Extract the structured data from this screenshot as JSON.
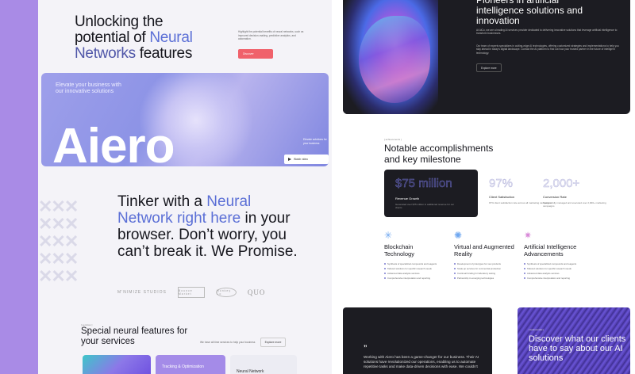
{
  "left": {
    "hero": {
      "line1": "Unlocking the",
      "line2a": "potential of ",
      "line2b": "Neural",
      "line3a": "Networks",
      "line3b": " features",
      "desc": "Highlight the potential benefits of neural networks, such as improved decision-making, predictive analytics, and automation.",
      "button": "Discover"
    },
    "banner": {
      "tagline": "Elevate your business with our innovative solutions",
      "brand": "Aiero",
      "side_text": "Elevate solutions for your business",
      "watch": "Watch video"
    },
    "tinker": {
      "a": "Tinker with a ",
      "b": "Neural Network right here",
      "c": " in your browser. Don’t worry, you can’t break it. We Promise."
    },
    "logos": [
      "M’NIMIZE STUDIOS",
      "Bounce Market",
      "Monkey Co",
      "QUO"
    ],
    "features": {
      "tag": "[ services ]",
      "title": "Special neural features for your services",
      "desc": "We have all time services to help your business",
      "button": "Explore more",
      "card2": "Tracking & Optimization",
      "card3": "Neural Network"
    }
  },
  "right": {
    "dark": {
      "heading": "Pioneers in artificial intelligence solutions and innovation",
      "p1": "At AiCo, we are a leading AI services provider dedicated to delivering innovative solutions that leverage artificial intelligence to transform businesses.",
      "p2": "Our team of experts specializes in cutting-edge AI technologies, offering customized strategies and implementations to help you stay ahead in today's digital landscape. Contact the AI platform to find out how your trusted partner in the future of intelligent technology.",
      "button": "Explore more"
    },
    "accomplish": {
      "tag": "[ achievements ]",
      "title": "Notable accomplishments and key milestone",
      "stats": [
        {
          "num": "$75 million",
          "label": "Revenue Growth",
          "desc": "Generated over $75 million in additional revenue for our clients"
        },
        {
          "num": "97%",
          "label": "Client Satisfaction",
          "desc": "97% client satisfaction rate across all marketing campaigns"
        },
        {
          "num": "2,000+",
          "label": "Conversion Rate",
          "desc": "Successfully managed and executed over 2,000+ marketing campaigns"
        }
      ]
    },
    "tech": [
      {
        "icon": "blockchain-icon",
        "title": "Blockchain Technology",
        "items": [
          "Synthesis of specialized compounds and reagents",
          "Tailored solutions for specific research needs",
          "Advanced data analysis services",
          "Comprehensive interpretation and reporting"
        ]
      },
      {
        "icon": "vr-icon",
        "title": "Virtual and Augmented Reality",
        "items": [
          "Development of prototypes for new products",
          "Scale-up services for commercial production",
          "Continual funding for laboratory testing",
          "Partnership in emerging technologies"
        ]
      },
      {
        "icon": "ai-icon",
        "title": "Artificial Intelligence Advancements",
        "items": [
          "Synthesis of specialized compounds and reagents",
          "Tailored solutions for specific research needs",
          "Advanced data analysis services",
          "Comprehensive interpretation and reporting"
        ]
      }
    ],
    "testimonial": {
      "quote_mark": "”",
      "text": "Working with Aiero has been a game-changer for our business. Their AI solutions have revolutionized our operations, enabling us to automate repetitive tasks and make data-driven decisions with ease. We couldn't"
    },
    "discover": {
      "tag": "[ testimonials ]",
      "title": "Discover what our clients have to say about our AI solutions"
    }
  }
}
